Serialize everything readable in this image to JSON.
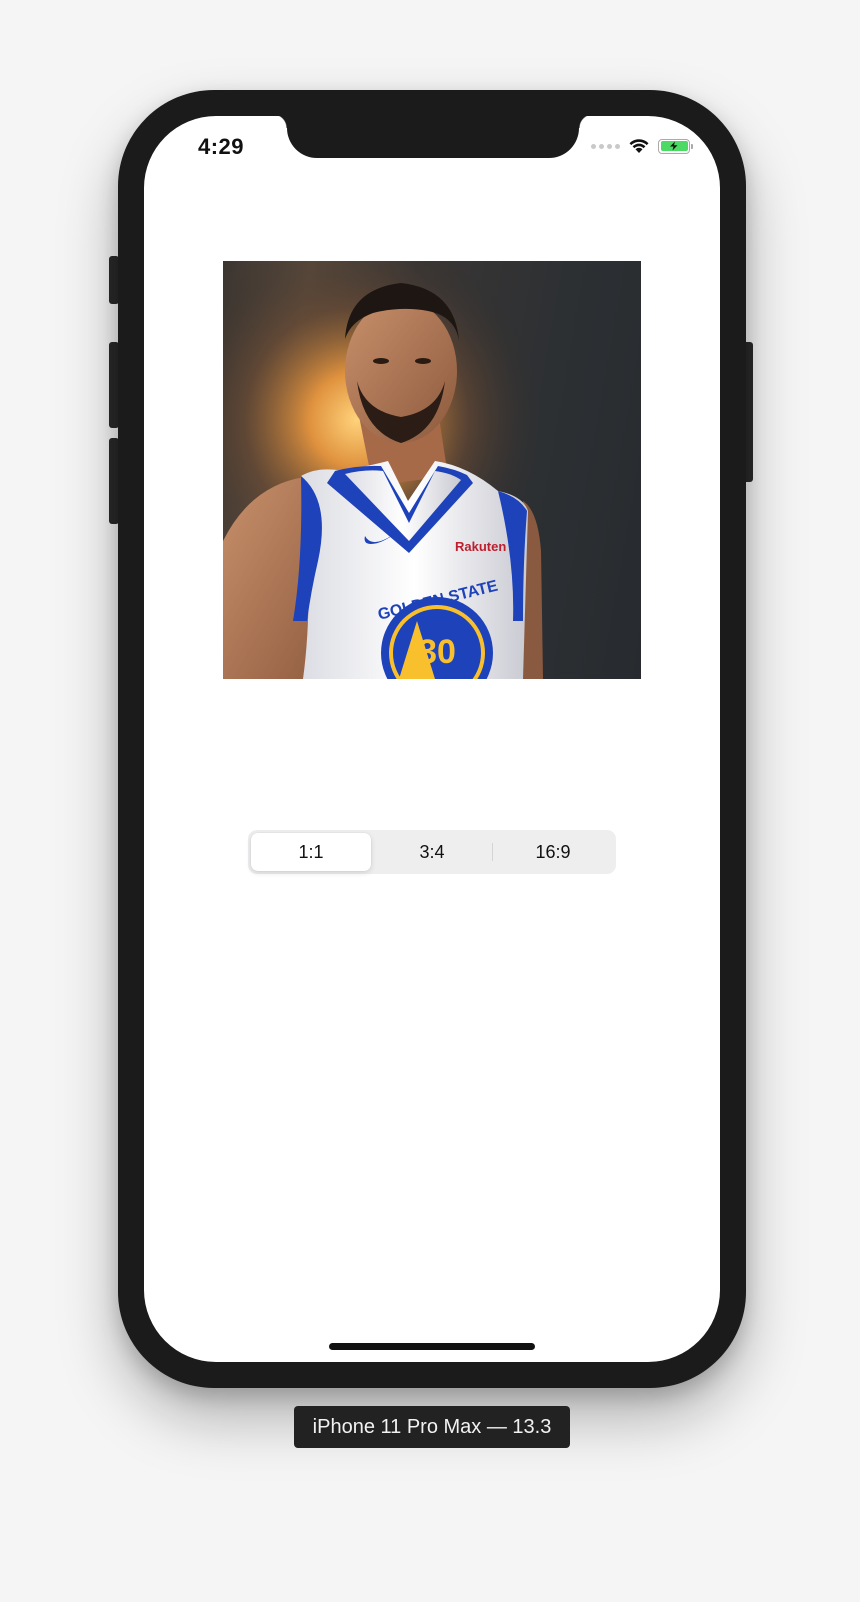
{
  "status_bar": {
    "time": "4:29",
    "battery_color": "#4cd964"
  },
  "photo": {
    "jersey_team": "GOLDEN STATE",
    "jersey_number": "30",
    "jersey_sponsor": "Rakuten"
  },
  "segmented_control": {
    "segments": [
      {
        "label": "1:1",
        "selected": true
      },
      {
        "label": "3:4",
        "selected": false
      },
      {
        "label": "16:9",
        "selected": false
      }
    ]
  },
  "device_label": "iPhone 11 Pro Max — 13.3",
  "colors": {
    "device_frame": "#1b1b1b",
    "screen_bg": "#ffffff",
    "jersey_blue": "#1d42ba",
    "jersey_gold": "#f9c02e"
  }
}
